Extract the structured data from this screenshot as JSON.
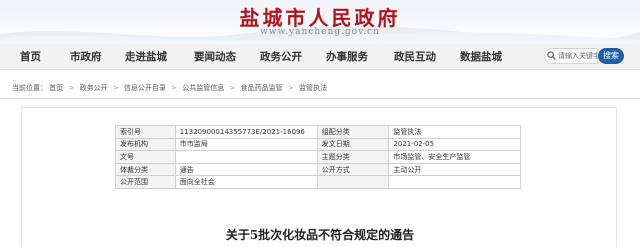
{
  "site": {
    "title": "盐城市人民政府",
    "domain": "www.yancheng.gov.cn",
    "brand_color": "#b5121b",
    "accent_color": "#1f5fa8"
  },
  "nav": {
    "items": [
      "首页",
      "市政府",
      "走进盐城",
      "要闻动态",
      "政务公开",
      "办事服务",
      "政民互动",
      "数据盐城"
    ]
  },
  "search": {
    "placeholder": "请输入关键字",
    "button_label": "搜索",
    "icon": "search-icon"
  },
  "breadcrumb": {
    "label": "当前位置：",
    "items": [
      "首页",
      "政务公开",
      "信息公开目录",
      "公共监管信息",
      "食品药品监管",
      "监管执法"
    ],
    "separator": ">"
  },
  "meta_table": {
    "rows": [
      {
        "k1": "索引号",
        "v1": "11320900014355773E/2021-16096",
        "k2": "组配分类",
        "v2": "监管执法"
      },
      {
        "k1": "发布机构",
        "v1": "市市监局",
        "k2": "发文日期",
        "v2": "2021-02-05"
      },
      {
        "k1": "文号",
        "v1": "",
        "k2": "主题分类",
        "v2": "市场监管、安全生产监管"
      },
      {
        "k1": "体裁分类",
        "v1": "通告",
        "k2": "公开方式",
        "v2": "主动公开"
      },
      {
        "k1": "公开范围",
        "v1": "面向全社会",
        "k2": "",
        "v2": ""
      }
    ]
  },
  "document": {
    "title": "关于5批次化妆品不符合规定的通告"
  }
}
